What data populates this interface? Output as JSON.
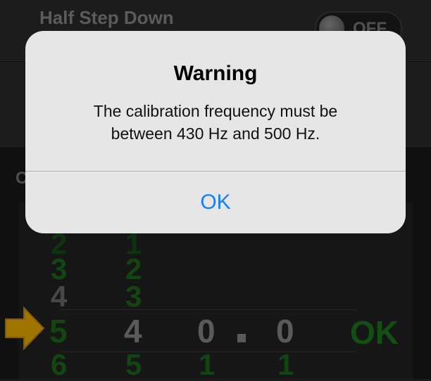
{
  "settings": {
    "half_step_label": "Half Step Down",
    "half_step_state": "OFF",
    "section_initial": "C"
  },
  "picker": {
    "col1": [
      "2",
      "3",
      "4",
      "5",
      "6"
    ],
    "col2": [
      "1",
      "2",
      "3",
      "4",
      "5"
    ],
    "col3": [
      "0",
      "1"
    ],
    "decimal": ".",
    "col4": [
      "0",
      "1"
    ],
    "ok_label": "OK"
  },
  "alert": {
    "title": "Warning",
    "message_line1": "The calibration frequency must be",
    "message_line2": "between 430 Hz and 500 Hz.",
    "button": "OK",
    "button_color": "#147efb"
  },
  "colors": {
    "picker_green": "#1d6a1d",
    "arrow": "#f5b400"
  }
}
